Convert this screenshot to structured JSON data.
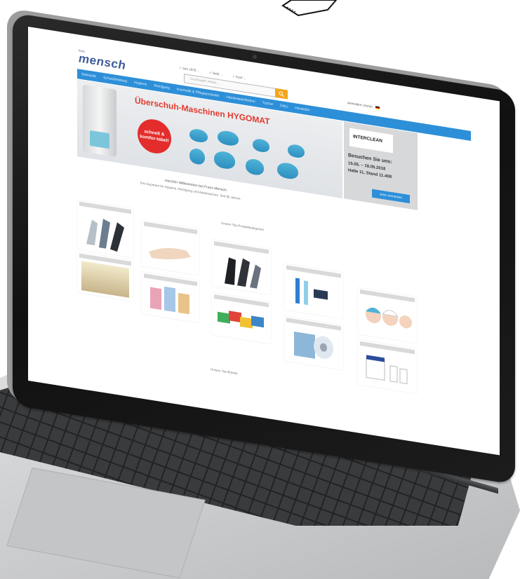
{
  "site": {
    "logo": "mensch",
    "trust": [
      "✓ Seit 1878 ...",
      "✓ Bald ...",
      "✓ Kauf ..."
    ],
    "search_placeholder": "Suchbegriff, Artikel...",
    "account": "Anmelden | Konto",
    "nav": [
      "Startseite",
      "Schutzkleidung",
      "Hygiene",
      "Reinigung",
      "Kosmetik & Pflegeprodukte",
      "Händedesinfektion",
      "Tücher",
      "DALI",
      "Hersteller"
    ],
    "banner_title": "Überschuh-Maschinen HYGOMAT",
    "badge": "schnell & komfor-tabel!",
    "ad": {
      "logo": "INTERCLEAN",
      "headline": "Besuchen Sie uns:",
      "dates": "15.05. – 18.05.2018",
      "hall": "Halle 11, Stand 11.408",
      "button": "Jetzt vormerken"
    },
    "welcome": "Herzlich Willkommen bei Franz Mensch",
    "welcome_sub": "Ihre Experten für Hygiene, Reinigung und Arbeitsschutz. Seit 85 Jahren.",
    "top_categories": "Unsere Top-Produktkategorien",
    "top_brands": "Unsere Top-Brands"
  }
}
